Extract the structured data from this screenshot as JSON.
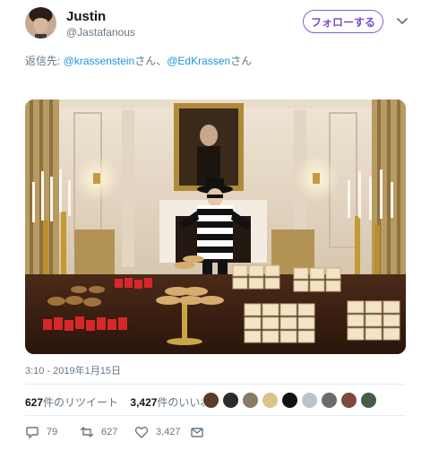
{
  "user": {
    "display_name": "Justin",
    "handle": "@Jastafanous"
  },
  "follow_button": {
    "label": "フォローする"
  },
  "reply": {
    "prefix": "返信先: ",
    "mention1": "@krassenstein",
    "joiner": "さん、",
    "mention2": "@EdKrassen",
    "suffix": "さん"
  },
  "tweet": {
    "timestamp": "3:10 - 2019年1月15日"
  },
  "stats": {
    "retweets_count": "627",
    "retweets_label": "件のリツイート",
    "likes_count": "3,427",
    "likes_label": "件のいいね"
  },
  "actions": {
    "replies": "79",
    "retweets": "627",
    "likes": "3,427"
  },
  "colors": {
    "accent": "#1b95e0",
    "follow": "#7b4dc8",
    "muted": "#657786"
  },
  "icons": [
    "chevron-down-icon",
    "reply-icon",
    "retweet-icon",
    "like-icon",
    "mail-icon"
  ]
}
